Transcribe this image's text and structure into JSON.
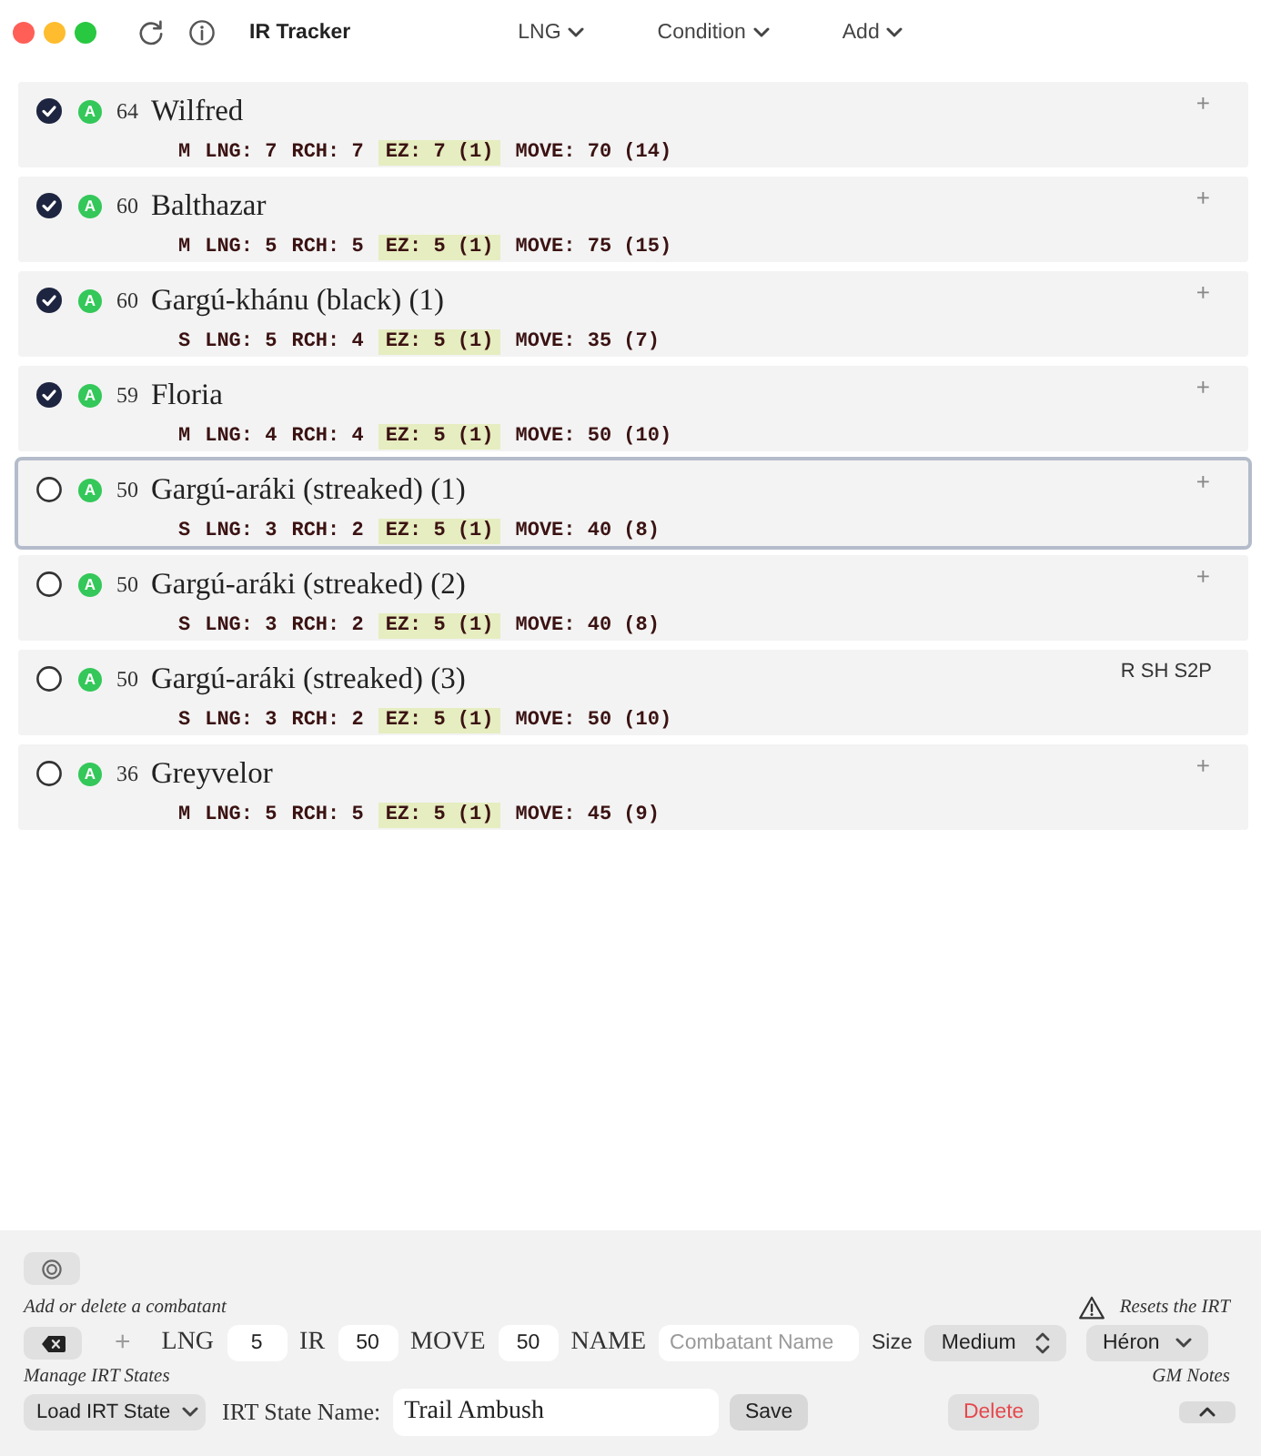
{
  "window": {
    "title": "IR Tracker"
  },
  "menus": [
    {
      "label": "LNG"
    },
    {
      "label": "Condition"
    },
    {
      "label": "Add"
    }
  ],
  "combatants": [
    {
      "checked": true,
      "selected": false,
      "status": "A",
      "ir": "64",
      "name": "Wilfred",
      "size": "M",
      "lng": "LNG: 7",
      "rch": "RCH: 7",
      "ez": "EZ: 7 (1)",
      "move": "MOVE: 70 (14)",
      "add_button": "+"
    },
    {
      "checked": true,
      "selected": false,
      "status": "A",
      "ir": "60",
      "name": "Balthazar",
      "size": "M",
      "lng": "LNG: 5",
      "rch": "RCH: 5",
      "ez": "EZ: 5 (1)",
      "move": "MOVE: 75 (15)",
      "add_button": "+"
    },
    {
      "checked": true,
      "selected": false,
      "status": "A",
      "ir": "60",
      "name": "Gargú-khánu (black) (1)",
      "size": "S",
      "lng": "LNG: 5",
      "rch": "RCH: 4",
      "ez": "EZ: 5 (1)",
      "move": "MOVE: 35 (7)",
      "add_button": "+"
    },
    {
      "checked": true,
      "selected": false,
      "status": "A",
      "ir": "59",
      "name": "Floria",
      "size": "M",
      "lng": "LNG: 4",
      "rch": "RCH: 4",
      "ez": "EZ: 5 (1)",
      "move": "MOVE: 50 (10)",
      "add_button": "+"
    },
    {
      "checked": false,
      "selected": true,
      "status": "A",
      "ir": "50",
      "name": "Gargú-aráki (streaked) (1)",
      "size": "S",
      "lng": "LNG: 3",
      "rch": "RCH: 2",
      "ez": "EZ: 5 (1)",
      "move": "MOVE: 40 (8)",
      "add_button": "+"
    },
    {
      "checked": false,
      "selected": false,
      "status": "A",
      "ir": "50",
      "name": "Gargú-aráki (streaked) (2)",
      "size": "S",
      "lng": "LNG: 3",
      "rch": "RCH: 2",
      "ez": "EZ: 5 (1)",
      "move": "MOVE: 40 (8)",
      "add_button": "+"
    },
    {
      "checked": false,
      "selected": false,
      "status": "A",
      "ir": "50",
      "name": "Gargú-aráki (streaked) (3)",
      "size": "S",
      "lng": "LNG: 3",
      "rch": "RCH: 2",
      "ez": "EZ: 5 (1)",
      "move": "MOVE: 50 (10)",
      "conditions": "R SH S2P"
    },
    {
      "checked": false,
      "selected": false,
      "status": "A",
      "ir": "36",
      "name": "Greyvelor",
      "size": "M",
      "lng": "LNG: 5",
      "rch": "RCH: 5",
      "ez": "EZ: 5 (1)",
      "move": "MOVE: 45 (9)",
      "add_button": "+"
    }
  ],
  "footer": {
    "add_caption": "Add or delete a combatant",
    "add_button": {
      "label": "+",
      "disabled": true
    },
    "fields": [
      {
        "kind": "number",
        "label": "LNG",
        "value": "5"
      },
      {
        "kind": "number",
        "label": "IR",
        "value": "50"
      },
      {
        "kind": "number",
        "label": "MOVE",
        "value": "50"
      },
      {
        "kind": "text",
        "label": "NAME",
        "placeholder": "Combatant Name"
      }
    ],
    "size": {
      "label": "Size",
      "value": "Medium"
    },
    "reset_caption": "Resets the IRT",
    "reset_select": "Héron",
    "states_caption": "Manage IRT States",
    "notes_caption": "GM Notes",
    "load_select": "Load IRT State",
    "state_name": {
      "label": "IRT State Name:",
      "value": "Trail Ambush"
    },
    "save_button": "Save",
    "delete_button": "Delete"
  }
}
